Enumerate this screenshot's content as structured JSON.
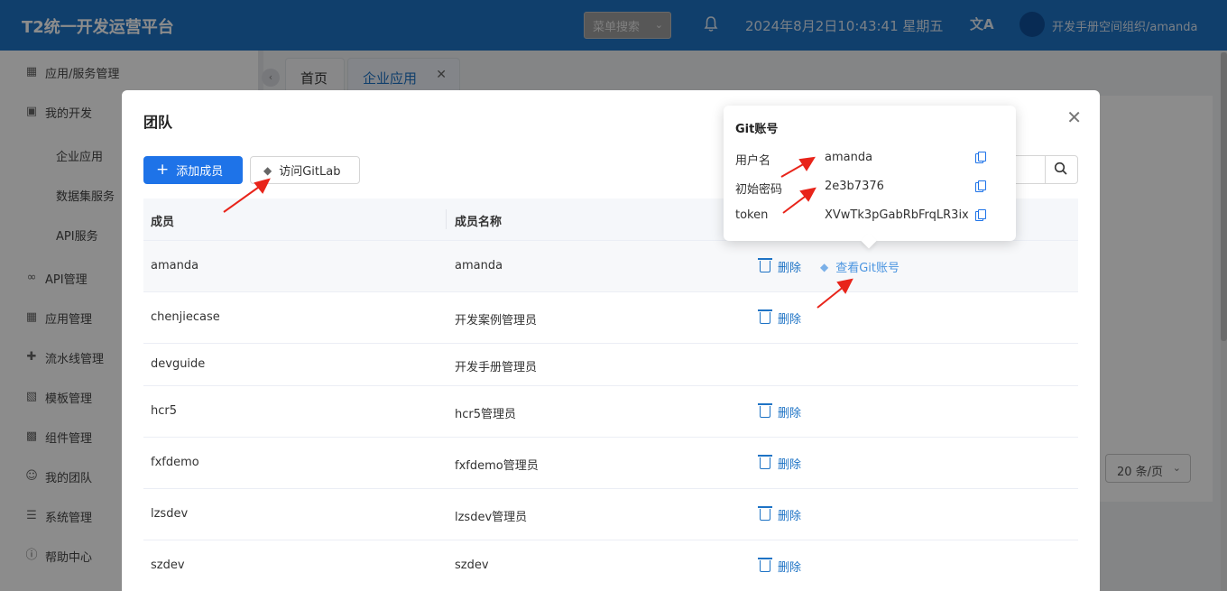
{
  "header": {
    "app_title": "T2统一开发运营平台",
    "menu_search": "菜单搜索",
    "datetime": "2024年8月2日10:43:41 星期五",
    "org_name": "开发手册空间组织/amanda"
  },
  "sidebar": {
    "items": [
      {
        "label": "应用/服务管理",
        "icon": "grid-icon"
      },
      {
        "label": "我的开发",
        "icon": "layout-icon"
      },
      {
        "label": "企业应用",
        "sub": true
      },
      {
        "label": "数据集服务",
        "sub": true
      },
      {
        "label": "API服务",
        "sub": true
      },
      {
        "label": "API管理",
        "icon": "link-icon"
      },
      {
        "label": "应用管理",
        "icon": "grid-icon"
      },
      {
        "label": "流水线管理",
        "icon": "pipeline-icon"
      },
      {
        "label": "模板管理",
        "icon": "template-icon"
      },
      {
        "label": "组件管理",
        "icon": "component-icon"
      },
      {
        "label": "我的团队",
        "icon": "team-icon"
      },
      {
        "label": "系统管理",
        "icon": "system-icon"
      },
      {
        "label": "帮助中心",
        "icon": "help-icon"
      }
    ]
  },
  "tabs": {
    "home": "首页",
    "enterprise": "企业应用"
  },
  "background": {
    "per_page": "20 条/页"
  },
  "modal": {
    "title": "团队",
    "add_member": "添加成员",
    "visit_gitlab": "访问GitLab",
    "columns": {
      "member": "成员",
      "member_name": "成员名称"
    },
    "delete_label": "删除",
    "view_git_label": "查看Git账号",
    "rows": [
      {
        "member": "amanda",
        "name": "amanda",
        "delete": true,
        "git": true
      },
      {
        "member": "chenjiecase",
        "name": "开发案例管理员",
        "delete": true,
        "git": false
      },
      {
        "member": "devguide",
        "name": "开发手册管理员",
        "delete": false,
        "git": false
      },
      {
        "member": "hcr5",
        "name": "hcr5管理员",
        "delete": true,
        "git": false
      },
      {
        "member": "fxfdemo",
        "name": "fxfdemo管理员",
        "delete": true,
        "git": false
      },
      {
        "member": "lzsdev",
        "name": "lzsdev管理员",
        "delete": true,
        "git": false
      },
      {
        "member": "szdev",
        "name": "szdev",
        "delete": true,
        "git": false
      }
    ]
  },
  "popover": {
    "title": "Git账号",
    "fields": [
      {
        "key": "用户名",
        "value": "amanda"
      },
      {
        "key": "初始密码",
        "value": "2e3b7376"
      },
      {
        "key": "token",
        "value": "XVwTk3pGabRbFrqLR3ix"
      }
    ]
  },
  "colors": {
    "header_bg": "#1e73c5",
    "primary": "#1e73e8",
    "annotation": "#e8241a"
  }
}
